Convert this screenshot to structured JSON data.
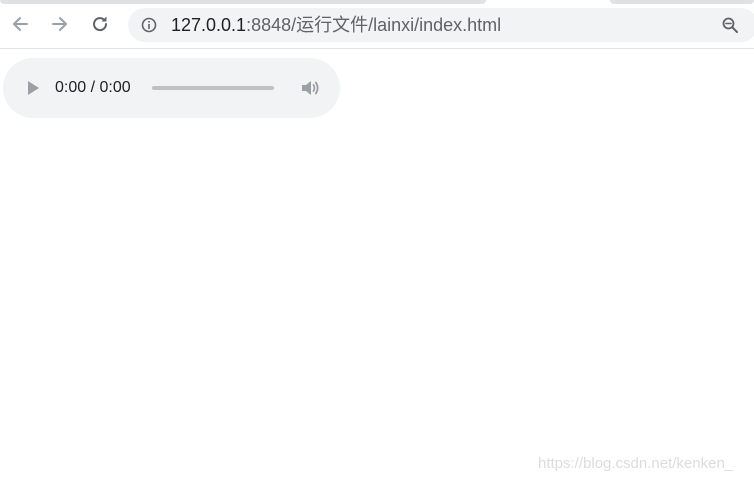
{
  "browser": {
    "nav": {
      "back_icon": "arrow-left-icon",
      "forward_icon": "arrow-right-icon",
      "reload_icon": "reload-icon"
    },
    "address_bar": {
      "security_icon": "info-icon",
      "url_host": "127.0.0.1",
      "url_rest": ":8848/运行文件/lainxi/index.html",
      "zoom_icon": "zoom-icon"
    }
  },
  "audio_player": {
    "play_icon": "play-icon",
    "time": "0:00 / 0:00",
    "progress_fraction": 0,
    "volume_icon": "volume-icon"
  },
  "watermark": {
    "text": "https://blog.csdn.net/kenken_"
  },
  "colors": {
    "chrome_background": "#ffffff",
    "omnibox_background": "#f1f3f4",
    "player_background": "#f1f3f4",
    "icon_gray": "#5f6368",
    "disabled_icon_gray": "#9aa0a6",
    "progress_track": "#c1c1c1"
  }
}
